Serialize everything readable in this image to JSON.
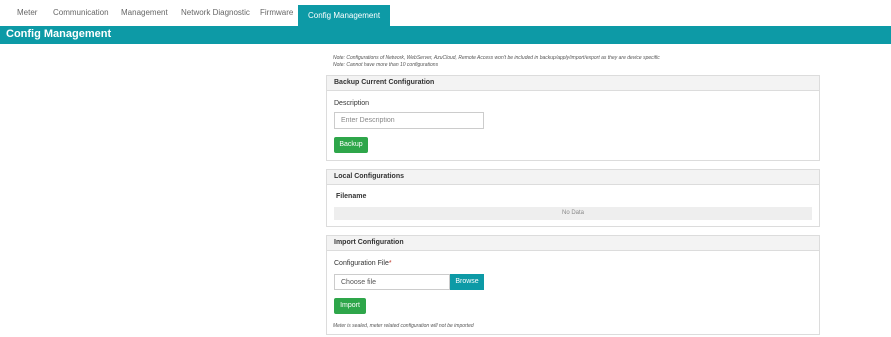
{
  "tabs": [
    {
      "label": "Meter",
      "active": false
    },
    {
      "label": "Communication",
      "active": false
    },
    {
      "label": "Management",
      "active": false
    },
    {
      "label": "Network Diagnostic",
      "active": false
    },
    {
      "label": "Firmware",
      "active": false
    },
    {
      "label": "Config Management",
      "active": true
    }
  ],
  "page_title": "Config Management",
  "notes": {
    "line1": "Note: Configurations of Network, WebServer, AzuCloud, Remote Access won't be included in backup/apply/import/export as they are device specific",
    "line2": "Note: Cannot have more than 10 configurations"
  },
  "backup": {
    "header": "Backup Current Configuration",
    "description_label": "Description",
    "description_placeholder": "Enter Description",
    "description_value": "",
    "button_label": "Backup"
  },
  "local": {
    "header": "Local Configurations",
    "column_filename": "Filename",
    "empty_text": "No Data"
  },
  "import": {
    "header": "Import Configuration",
    "file_label": "Configuration File",
    "required_mark": "*",
    "file_placeholder": "Choose file",
    "browse_label": "Browse",
    "button_label": "Import",
    "warning": "Meter is sealed, meter related configuration will not be imported"
  },
  "colors": {
    "accent": "#0d9aa6",
    "button_green": "#2ea64a"
  }
}
